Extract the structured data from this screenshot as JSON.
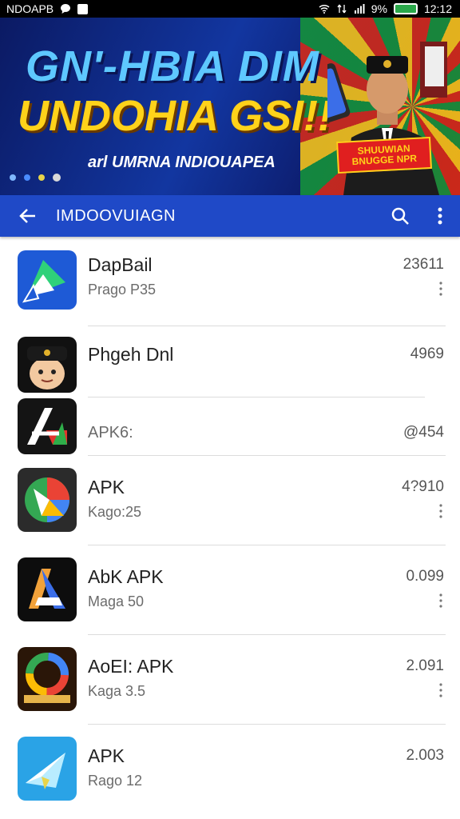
{
  "status_bar": {
    "carrier": "NDOAPB",
    "battery_percent": "9%",
    "time": "12:12"
  },
  "banner": {
    "headline_line1": "GN'-HBIA DIM",
    "headline_line2": "UNDOHIA GSI!!",
    "tagline": "arl UMRNA INDIOUAPEA",
    "badge_line1": "SHUUWIAN",
    "badge_line2": "BNUGGE NPR",
    "carousel_pages": 4,
    "carousel_active_index": 3
  },
  "app_bar": {
    "title": "IMDOOVUIAGN",
    "back_icon": "arrow-back-icon",
    "search_icon": "search-icon",
    "menu_icon": "more-vert-icon"
  },
  "apps": [
    {
      "name": "DapBail",
      "subtitle": "Prago P35",
      "value": "23611",
      "icon": "blue-map-arrow-icon"
    },
    {
      "name": "Phgeh Dnl",
      "subtitle": "",
      "value": "4969",
      "icon": "cartoon-officer-icon"
    },
    {
      "name": "",
      "subtitle": "APK6:",
      "value": "@454",
      "icon": "letter-a-dark-icon"
    },
    {
      "name": "APK",
      "subtitle": "Kago:25",
      "value": "4?910",
      "icon": "maps-pin-icon"
    },
    {
      "name": "AbK APK",
      "subtitle": "Maga 50",
      "value": "0.099",
      "icon": "gradient-a-icon"
    },
    {
      "name": "AoEI: APK",
      "subtitle": "Kaga 3.5",
      "value": "2.091",
      "icon": "colorful-ring-icon"
    },
    {
      "name": "APK",
      "subtitle": "Rago 12",
      "value": "2.003",
      "icon": "paper-plane-icon"
    }
  ]
}
